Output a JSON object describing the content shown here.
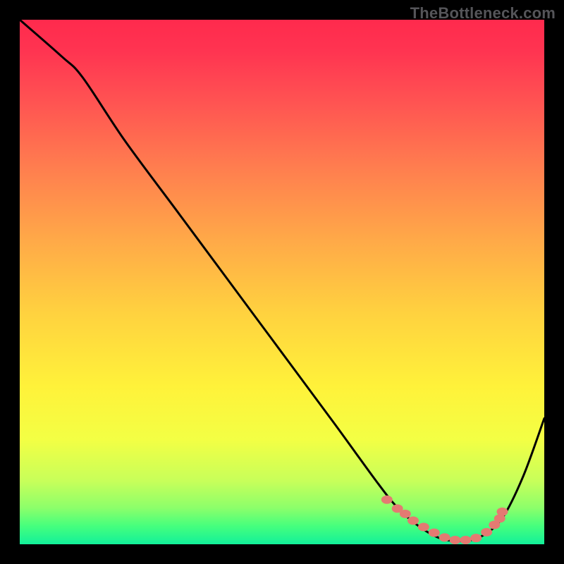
{
  "watermark": "TheBottleneck.com",
  "chart_data": {
    "type": "line",
    "title": "",
    "xlabel": "",
    "ylabel": "",
    "xlim": [
      0,
      100
    ],
    "ylim": [
      0,
      100
    ],
    "series": [
      {
        "name": "curve",
        "x": [
          0,
          8,
          12,
          20,
          30,
          40,
          50,
          60,
          68,
          72,
          76,
          80,
          84,
          88,
          92,
          96,
          100
        ],
        "y": [
          100,
          93,
          89,
          77,
          63.5,
          50,
          36.5,
          23,
          12,
          7,
          3.5,
          1.2,
          0.6,
          1.5,
          5,
          13,
          24
        ]
      }
    ],
    "flat_zone": {
      "dots_x": [
        70,
        72,
        73.5,
        75,
        77,
        79,
        81,
        83,
        85,
        87,
        89,
        90.5,
        91.5,
        92
      ],
      "dots_y": [
        8.5,
        6.8,
        5.8,
        4.5,
        3.3,
        2.2,
        1.3,
        0.8,
        0.8,
        1.2,
        2.3,
        3.7,
        4.9,
        6.2
      ]
    },
    "gradient_stops": [
      {
        "offset": 0.0,
        "color": "#ff2a4d"
      },
      {
        "offset": 0.06,
        "color": "#ff3451"
      },
      {
        "offset": 0.15,
        "color": "#ff5152"
      },
      {
        "offset": 0.28,
        "color": "#ff7d4f"
      },
      {
        "offset": 0.42,
        "color": "#ffa948"
      },
      {
        "offset": 0.56,
        "color": "#ffd23f"
      },
      {
        "offset": 0.7,
        "color": "#fff23a"
      },
      {
        "offset": 0.8,
        "color": "#f3ff44"
      },
      {
        "offset": 0.88,
        "color": "#c7ff5a"
      },
      {
        "offset": 0.93,
        "color": "#8dff6a"
      },
      {
        "offset": 0.965,
        "color": "#46ff7d"
      },
      {
        "offset": 1.0,
        "color": "#12f09a"
      }
    ]
  }
}
